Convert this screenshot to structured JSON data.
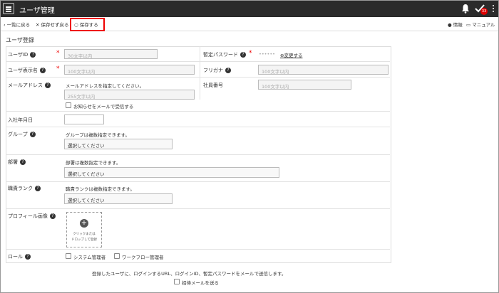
{
  "header": {
    "title": "ユーザ管理",
    "badge_count": "33"
  },
  "toolbar": {
    "back_label": "一覧に戻る",
    "discard_label": "保存せず戻る",
    "save_label": "保存する",
    "info_label": "情報",
    "manual_label": "マニュアル"
  },
  "section_title": "ユーザ登録",
  "fields": {
    "user_id": {
      "label": "ユーザID",
      "placeholder": "30文字以内"
    },
    "temp_password": {
      "label": "暫定パスワード",
      "value": "••••••",
      "change_link": "変更する"
    },
    "display_name": {
      "label": "ユーザ表示名",
      "placeholder": "100文字以内"
    },
    "furigana": {
      "label": "フリガナ",
      "placeholder": "100文字以内"
    },
    "email": {
      "label": "メールアドレス",
      "note": "メールアドレスを指定してください。",
      "placeholder": "255文字以内",
      "notify_label": "お知らせをメールで受信する"
    },
    "employee_no": {
      "label": "社員番号",
      "placeholder": "100文字以内"
    },
    "join_date": {
      "label": "入社年月日"
    },
    "group": {
      "label": "グループ",
      "note": "グループは複数指定できます。",
      "select": "選択してください"
    },
    "department": {
      "label": "部署",
      "note": "部署は複数指定できます。",
      "select": "選択してください"
    },
    "rank": {
      "label": "職責ランク",
      "note": "職責ランクは複数指定できます。",
      "select": "選択してください"
    },
    "profile_image": {
      "label": "プロフィール画像",
      "upload_line1": "クリックまたは",
      "upload_line2": "ドロップして登録"
    },
    "role": {
      "label": "ロール",
      "option1": "システム管理者",
      "option2": "ワークフロー管理者"
    }
  },
  "footer": {
    "note": "登録したユーザに、ログインするURL、ログインID、暫定パスワードをメールで送信します。",
    "send_invite_label": "招待メールを送る"
  }
}
